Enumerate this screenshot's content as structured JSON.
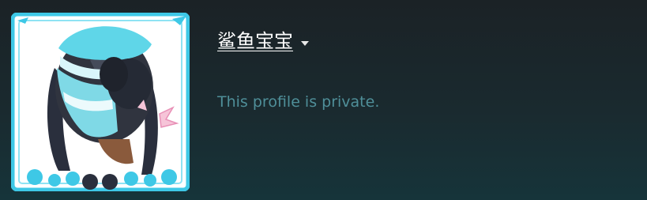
{
  "profile": {
    "persona_name": "鲨鱼宝宝",
    "privacy_message": "This profile is private.",
    "name_dropdown_icon": "caret-down-icon",
    "avatar_description": "anime-avatar-image"
  },
  "colors": {
    "frame_accent": "#3ec8e6",
    "private_text": "#4f8f99",
    "name_text": "#ffffff"
  }
}
